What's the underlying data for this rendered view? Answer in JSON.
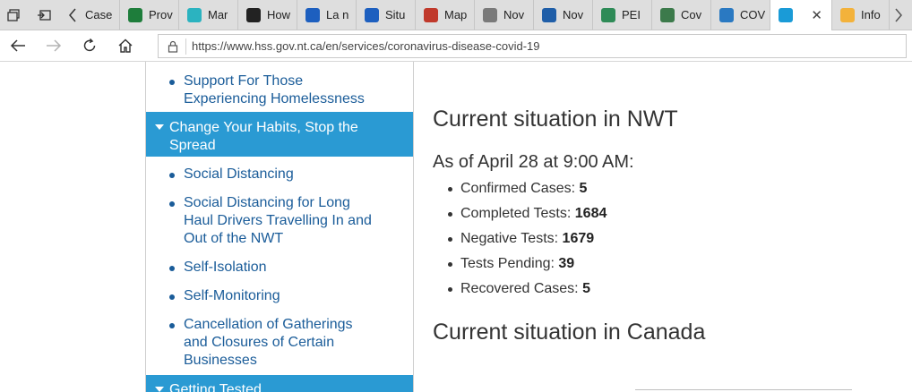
{
  "browser": {
    "tabs": [
      {
        "label": "Case",
        "icon": "document-icon",
        "color": "#ffffff",
        "fg": "#333"
      },
      {
        "label": "Prov",
        "icon": "province-logo-icon",
        "color": "#1e7d3b",
        "fg": "#fff"
      },
      {
        "label": "Mar",
        "icon": "map-icon",
        "color": "#2bb3c0",
        "fg": "#fff"
      },
      {
        "label": "How",
        "icon": "shield-icon",
        "color": "#222222",
        "fg": "#fff"
      },
      {
        "label": "La n",
        "icon": "quebec-flag-icon",
        "color": "#1d5fbf",
        "fg": "#fff"
      },
      {
        "label": "Situ",
        "icon": "quebec-flag-icon",
        "color": "#1d5fbf",
        "fg": "#fff"
      },
      {
        "label": "Map",
        "icon": "pen-icon",
        "color": "#c0392b",
        "fg": "#fff"
      },
      {
        "label": "Nov",
        "icon": "envelope-icon",
        "color": "#7a7a7a",
        "fg": "#fff"
      },
      {
        "label": "Nov",
        "icon": "nova-scotia-flag-icon",
        "color": "#1f5ea8",
        "fg": "#fff"
      },
      {
        "label": "PEI",
        "icon": "pei-logo-icon",
        "color": "#2e8b57",
        "fg": "#fff"
      },
      {
        "label": "Cov",
        "icon": "globe-icon",
        "color": "#3c7a4b",
        "fg": "#fff"
      },
      {
        "label": "COV",
        "icon": "circle-logo-icon",
        "color": "#2a79c2",
        "fg": "#fff"
      },
      {
        "label": "",
        "icon": "nwt-logo-icon",
        "color": "#1a9bd7",
        "fg": "#fff",
        "active": true
      },
      {
        "label": "Info",
        "icon": "sun-icon",
        "color": "#f3b23b",
        "fg": "#fff"
      }
    ],
    "url": "https://www.hss.gov.nt.ca/en/services/coronavirus-disease-covid-19"
  },
  "sidebar": {
    "item_homelessness": "Support For Those Experiencing Homelessness",
    "section_habits": "Change Your Habits, Stop the Spread",
    "item_social_distancing": "Social Distancing",
    "item_long_haul": "Social Distancing for Long Haul Drivers Travelling In and Out of the NWT",
    "item_self_isolation": "Self-Isolation",
    "item_self_monitoring": "Self-Monitoring",
    "item_gatherings": "Cancellation of Gatherings and Closures of Certain Businesses",
    "section_testing": "Getting Tested"
  },
  "main": {
    "heading_nwt": "Current situation in NWT",
    "as_of": "As of April 28 at 9:00 AM:",
    "stats": [
      {
        "label": "Confirmed Cases: ",
        "value": "5"
      },
      {
        "label": "Completed Tests: ",
        "value": "1684"
      },
      {
        "label": "Negative Tests: ",
        "value": "1679"
      },
      {
        "label": "Tests Pending: ",
        "value": "39"
      },
      {
        "label": "Recovered Cases: ",
        "value": "5"
      }
    ],
    "heading_canada": "Current situation in Canada"
  },
  "colors": {
    "section_bg": "#2a9ad3",
    "link": "#1a5c99",
    "text": "#333333"
  }
}
